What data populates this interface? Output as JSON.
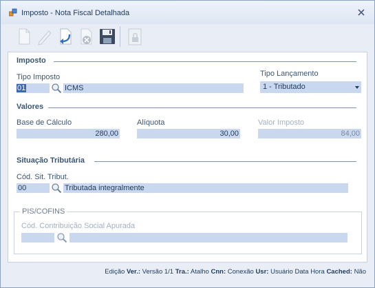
{
  "window": {
    "title": "Imposto - Nota Fiscal Detalhada"
  },
  "toolbar": {
    "buttons": [
      "new-document-icon",
      "edit-pencil-icon",
      "undo-arrow-icon",
      "delete-icon",
      "save-floppy-icon",
      "lock-icon"
    ]
  },
  "imposto": {
    "section_title": "Imposto",
    "tipo_imposto": {
      "label": "Tipo Imposto",
      "code": "01",
      "description": "ICMS"
    },
    "tipo_lancamento": {
      "label": "Tipo Lançamento",
      "value": "1 - Tributado"
    }
  },
  "valores": {
    "section_title": "Valores",
    "base_calculo": {
      "label": "Base de Cálculo",
      "value": "280,00"
    },
    "aliquota": {
      "label": "Alíquota",
      "value": "30,00"
    },
    "valor_imposto": {
      "label": "Valor Imposto",
      "value": "84,00"
    }
  },
  "situacao": {
    "section_title": "Situação Tributária",
    "cod_sit": {
      "label": "Cód. Sit. Tribut.",
      "code": "00",
      "description": "Tributada integralmente"
    }
  },
  "pis_cofins": {
    "group_title": "PIS/COFINS",
    "cod_contrib": {
      "label": "Cód. Contribuição Social Apurada",
      "code": "",
      "description": ""
    }
  },
  "status_bar": {
    "edicao": "Edição",
    "ver_label": "Ver.:",
    "ver_value": "Versão 1/1",
    "tra_label": "Tra.:",
    "tra_value": "Atalho",
    "cnn_label": "Cnn:",
    "cnn_value": "Conexão",
    "usr_label": "Usr:",
    "usr_value": "Usuário",
    "data_hora": "Data Hora",
    "cached_label": "Cached:",
    "cached_value": "Não"
  },
  "colors": {
    "field_bg": "#c9d8ef",
    "window_bg": "#e9eef6",
    "selection": "#3a66b8",
    "text": "#1e395b"
  }
}
